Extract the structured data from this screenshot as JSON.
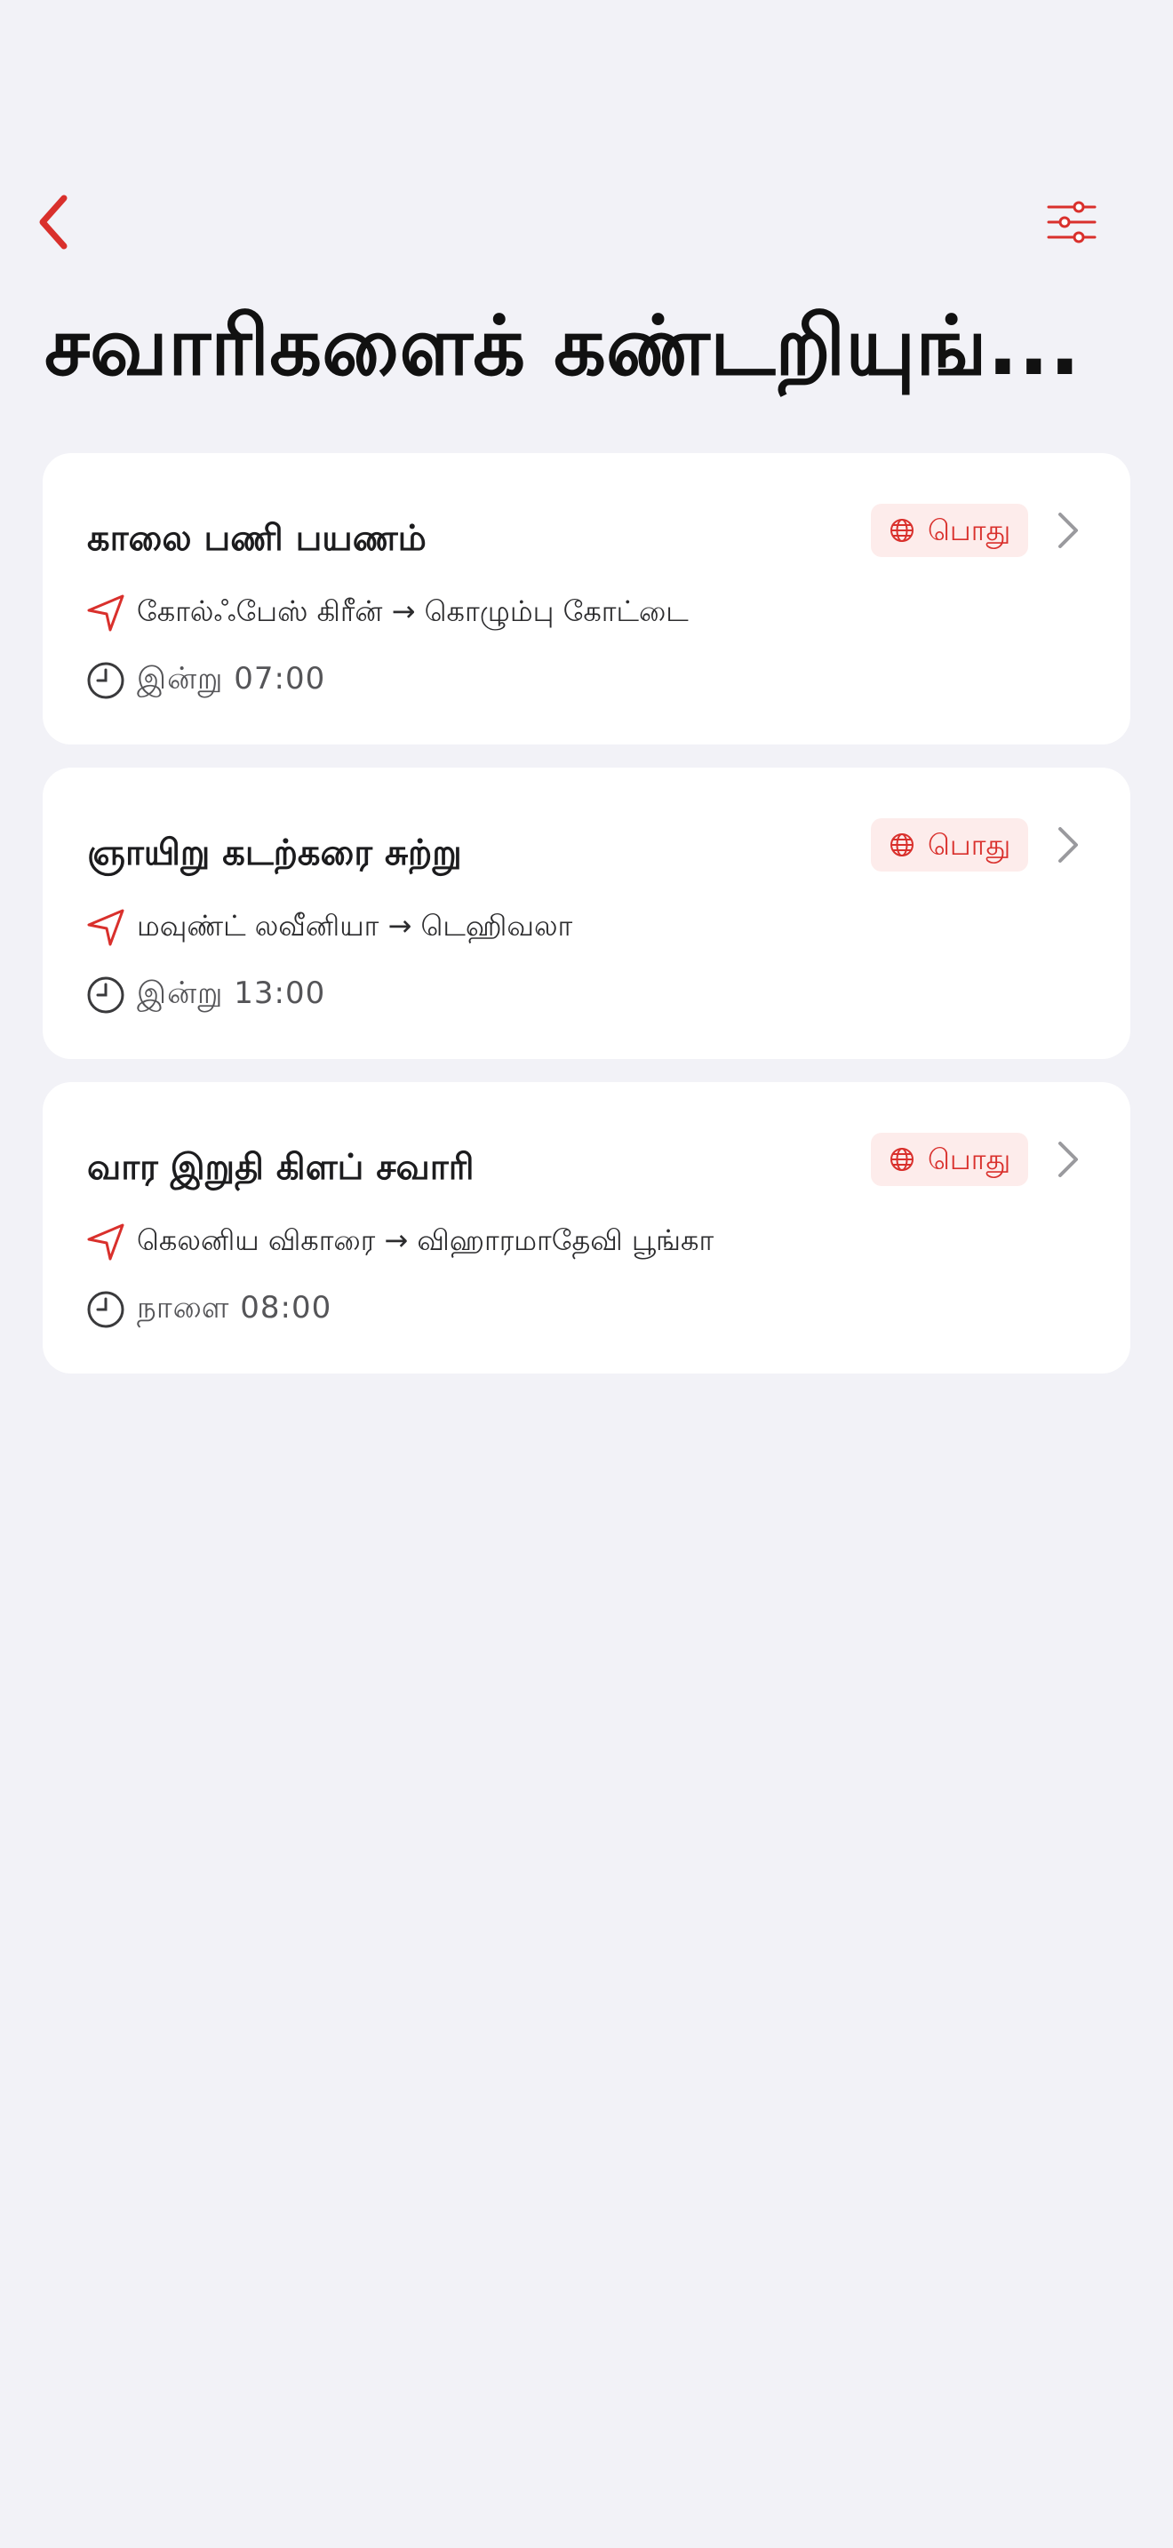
{
  "header": {
    "back_icon": "chevron-left-icon",
    "filter_icon": "sliders-icon",
    "accent_color": "#d9302c",
    "title": "சவாரிகளைக் கண்டறியுங்..."
  },
  "rides": [
    {
      "name": "காலை பணி பயணம்",
      "visibility": "பொது",
      "route": "கோல்ஃபேஸ் கிரீன் → கொழும்பு கோட்டை",
      "time": "இன்று 07:00"
    },
    {
      "name": "ஞாயிறு கடற்கரை சுற்று",
      "visibility": "பொது",
      "route": "மவுண்ட் லவீனியா → டெஹிவலா",
      "time": "இன்று 13:00"
    },
    {
      "name": "வார இறுதி கிளப் சவாரி",
      "visibility": "பொது",
      "route": "கெலனிய விகாரை → விஹாரமாதேவி பூங்கா",
      "time": "நாளை 08:00"
    }
  ]
}
